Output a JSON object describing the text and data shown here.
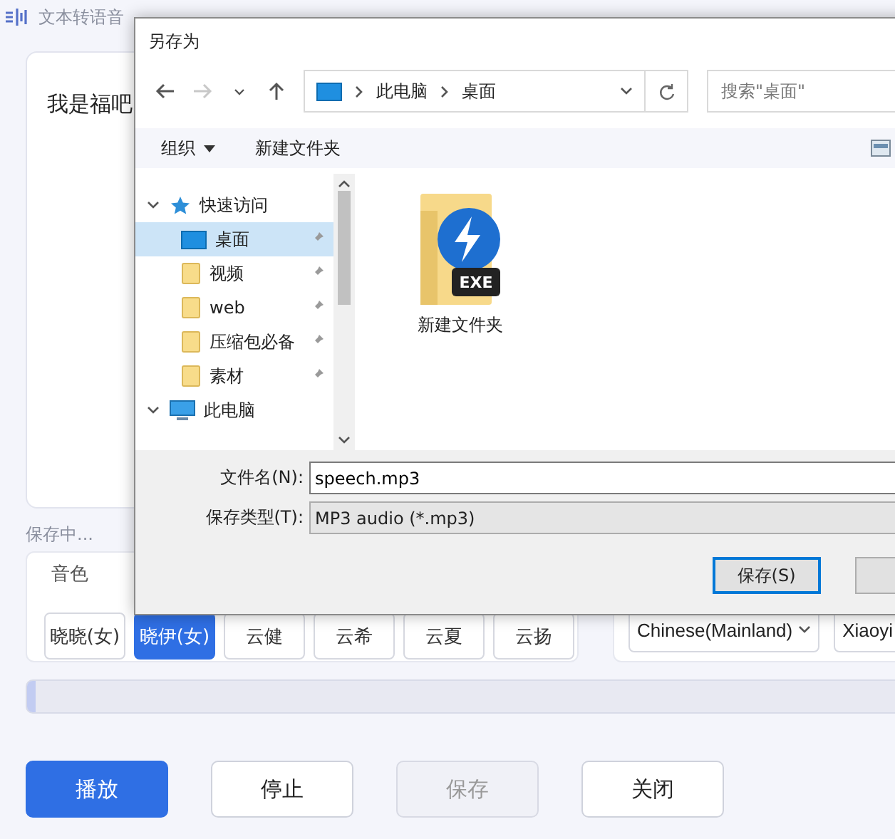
{
  "app": {
    "title": "文本转语音"
  },
  "text_input": {
    "value": "我是福吧"
  },
  "status": "保存中...",
  "voice": {
    "label": "音色",
    "options": [
      {
        "label": "晓晓(女)",
        "selected": false
      },
      {
        "label": "晓伊(女)",
        "selected": true
      },
      {
        "label": "云健",
        "selected": false
      },
      {
        "label": "云希",
        "selected": false
      },
      {
        "label": "云夏",
        "selected": false
      },
      {
        "label": "云扬",
        "selected": false
      }
    ]
  },
  "language_select": {
    "value": "Chinese(Mainland)"
  },
  "voice_select": {
    "value": "Xiaoyi"
  },
  "progress": {
    "level": 0.01
  },
  "buttons": [
    {
      "label": "播放",
      "kind": "primary",
      "disabled": false
    },
    {
      "label": "停止",
      "kind": "normal",
      "disabled": false
    },
    {
      "label": "保存",
      "kind": "normal",
      "disabled": true
    },
    {
      "label": "关闭",
      "kind": "normal",
      "disabled": false
    }
  ],
  "save_dialog": {
    "title": "另存为",
    "nav": [
      {
        "kind": "back",
        "disabled": false
      },
      {
        "kind": "forward",
        "disabled": true
      },
      {
        "kind": "recent",
        "disabled": false
      },
      {
        "kind": "up",
        "disabled": false
      }
    ],
    "breadcrumb": [
      "此电脑",
      "桌面"
    ],
    "search": {
      "placeholder": "搜索\"桌面\""
    },
    "toolbar": [
      {
        "label": "组织",
        "kind": "menu"
      },
      {
        "label": "新建文件夹",
        "kind": "button"
      }
    ],
    "tree": [
      {
        "label": "快速访问",
        "kind": "quick-access",
        "expanded": true,
        "selected": false,
        "children": [
          {
            "label": "桌面",
            "kind": "desktop",
            "selected": true,
            "pinned": true
          },
          {
            "label": "视频",
            "kind": "folder",
            "selected": false,
            "pinned": true
          },
          {
            "label": "web",
            "kind": "folder",
            "selected": false,
            "pinned": true
          },
          {
            "label": "压缩包必备",
            "kind": "folder",
            "selected": false,
            "pinned": true
          },
          {
            "label": "素材",
            "kind": "folder",
            "selected": false,
            "pinned": true
          }
        ]
      },
      {
        "label": "此电脑",
        "kind": "computer",
        "expanded": true,
        "selected": false
      }
    ],
    "files": [
      {
        "name": "新建文件夹",
        "badge": "EXE"
      }
    ],
    "file_name": {
      "label": "文件名(N):",
      "value": "speech.mp3"
    },
    "file_type": {
      "label": "保存类型(T):",
      "value": "MP3 audio (*.mp3)"
    },
    "buttons": [
      {
        "label": "保存(S)",
        "default": true
      }
    ]
  }
}
